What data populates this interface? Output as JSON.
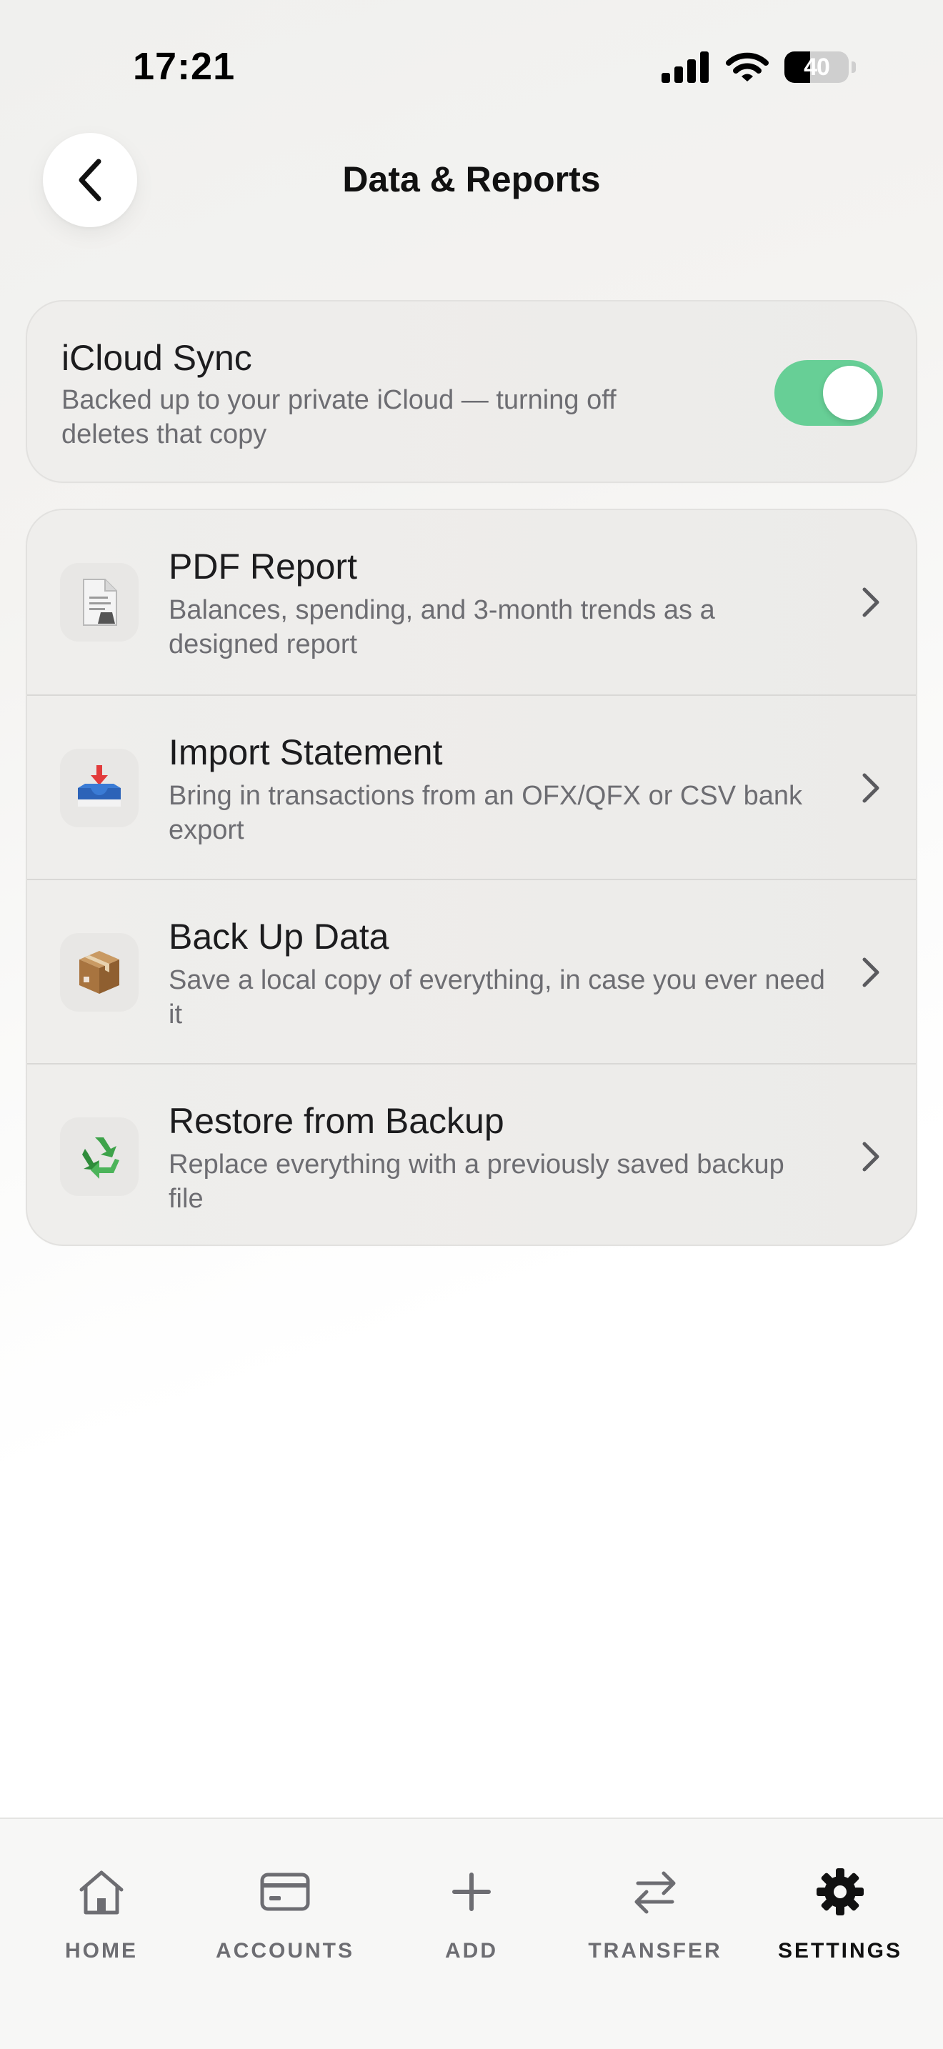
{
  "status_bar": {
    "time": "17:21",
    "battery_level": "40"
  },
  "header": {
    "title": "Data & Reports",
    "back_icon": "chevron-left-icon"
  },
  "icloud_sync": {
    "title": "iCloud Sync",
    "description": "Backed up to your private iCloud — turning off deletes that copy",
    "enabled": true,
    "toggle_color": "#67cf96"
  },
  "items": [
    {
      "title": "PDF Report",
      "description": "Balances, spending, and 3-month trends as a designed report",
      "icon": "document-icon"
    },
    {
      "title": "Import Statement",
      "description": "Bring in transactions from an OFX/QFX or CSV bank export",
      "icon": "inbox-tray-icon"
    },
    {
      "title": "Back Up Data",
      "description": "Save a local copy of everything, in case you ever need it",
      "icon": "package-icon"
    },
    {
      "title": "Restore from Backup",
      "description": "Replace everything with a previously saved backup file",
      "icon": "recycle-icon"
    }
  ],
  "tab_bar": {
    "tabs": [
      {
        "label": "HOME",
        "icon": "home-icon"
      },
      {
        "label": "ACCOUNTS",
        "icon": "card-icon"
      },
      {
        "label": "ADD",
        "icon": "plus-icon"
      },
      {
        "label": "TRANSFER",
        "icon": "transfer-icon"
      },
      {
        "label": "SETTINGS",
        "icon": "gear-icon",
        "active": true
      }
    ]
  }
}
